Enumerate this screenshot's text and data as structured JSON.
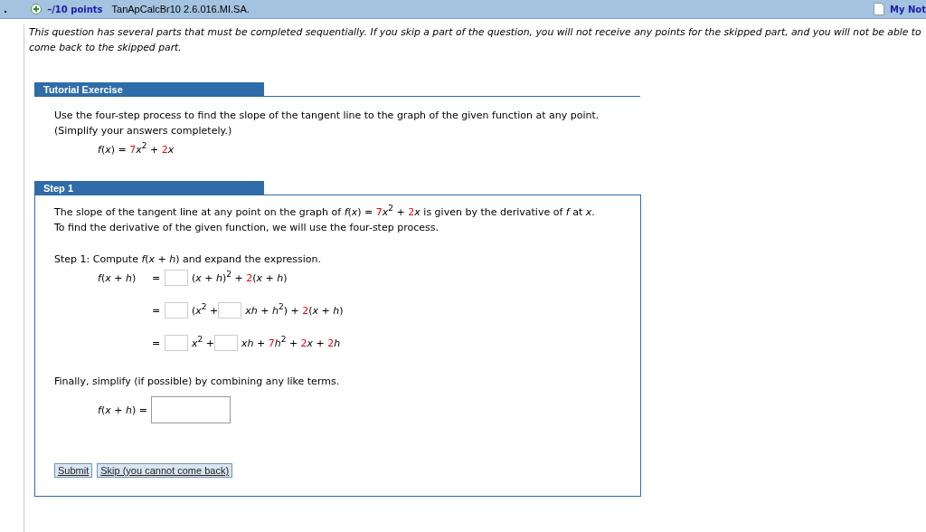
{
  "header": {
    "marker": ".",
    "points": "–/10 points",
    "code": "TanApCalcBr10 2.6.016.MI.SA.",
    "notes_link": "My Not"
  },
  "instructions": "This question has several parts that must be completed sequentially. If you skip a part of the question, you will not receive any points for the skipped part, and you will not be able to come back to the skipped part.",
  "tutorial": {
    "title": "Tutorial Exercise",
    "lines": [
      "Use the four-step process to find the slope of the tangent line to the graph of the given function at any point.",
      "(Simplify your answers completely.)"
    ],
    "function": [
      {
        "kind": "text",
        "s": "*f*(*x*) = "
      },
      {
        "kind": "given",
        "s": "7"
      },
      {
        "kind": "text",
        "s": "*x*$^{2}$ + "
      },
      {
        "kind": "given",
        "s": "2"
      },
      {
        "kind": "text",
        "s": "*x*"
      }
    ]
  },
  "step": {
    "title": "Step 1",
    "lines": [
      [
        {
          "kind": "text",
          "s": "The slope of the tangent line at any point on the graph of  *f*(*x*) = "
        },
        {
          "kind": "given",
          "s": "7"
        },
        {
          "kind": "text",
          "s": "*x*$^{2}$ + "
        },
        {
          "kind": "given",
          "s": "2"
        },
        {
          "kind": "text",
          "s": "*x*  is given by the derivative of *f* at *x*."
        }
      ],
      [
        {
          "kind": "text",
          "s": "To find the derivative of the given function, we will use the four-step process."
        }
      ]
    ],
    "task": "Step 1: Compute  *f*(*x* + *h*)  and expand the expression.",
    "rows": [
      {
        "lhs": "*f*(*x* + *h*)",
        "eq": "=",
        "rhs": [
          {
            "kind": "blank"
          },
          {
            "kind": "text",
            "s": "(*x* + *h*)$^{2}$ + "
          },
          {
            "kind": "given",
            "s": "2"
          },
          {
            "kind": "text",
            "s": "(*x* + *h*)"
          }
        ]
      },
      {
        "eq": "=",
        "rhs": [
          {
            "kind": "blank"
          },
          {
            "kind": "text",
            "s": "(*x*$^{2}$ +"
          },
          {
            "kind": "blank"
          },
          {
            "kind": "text",
            "s": "*xh* + *h*$^{2}$) + "
          },
          {
            "kind": "given",
            "s": "2"
          },
          {
            "kind": "text",
            "s": "(*x* + *h*)"
          }
        ]
      },
      {
        "eq": "=",
        "rhs": [
          {
            "kind": "blank"
          },
          {
            "kind": "text",
            "s": "*x*$^{2}$ +"
          },
          {
            "kind": "blank"
          },
          {
            "kind": "text",
            "s": "*xh* + "
          },
          {
            "kind": "given",
            "s": "7"
          },
          {
            "kind": "text",
            "s": "*h*$^{2}$ + "
          },
          {
            "kind": "given",
            "s": "2"
          },
          {
            "kind": "text",
            "s": "*x* + "
          },
          {
            "kind": "given",
            "s": "2"
          },
          {
            "kind": "text",
            "s": "*h*"
          }
        ]
      }
    ],
    "final_text": "Finally, simplify (if possible) by combining any like terms.",
    "final_label": "*f*(*x* + *h*) =",
    "buttons": [
      "Submit",
      "Skip (you cannot come back)"
    ]
  }
}
